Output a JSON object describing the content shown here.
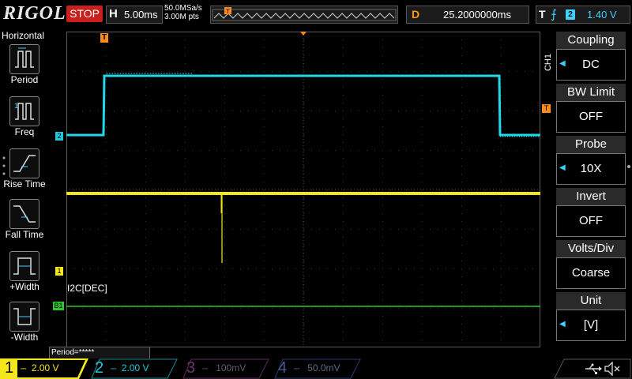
{
  "header": {
    "logo": "RIGOL",
    "run_state": "STOP",
    "horizontal": {
      "label": "H",
      "value": "5.00ms"
    },
    "sample_rate": "50.0MSa/s",
    "memory_depth": "3.00M pts",
    "delay": {
      "label": "D",
      "value": "25.2000000ms"
    },
    "trigger": {
      "label": "T",
      "edge_icon": "rising-edge-icon",
      "channel": "2",
      "level": "1.40 V"
    }
  },
  "left_menu": {
    "title": "Horizontal",
    "items": [
      {
        "label": "Period",
        "icon": "period-icon"
      },
      {
        "label": "Freq",
        "icon": "freq-icon"
      },
      {
        "label": "Rise Time",
        "icon": "rise-time-icon"
      },
      {
        "label": "Fall Time",
        "icon": "fall-time-icon"
      },
      {
        "label": "+Width",
        "icon": "positive-width-icon"
      },
      {
        "label": "-Width",
        "icon": "negative-width-icon"
      }
    ]
  },
  "right_menu": {
    "channel_tag": "CH1",
    "items": [
      {
        "title": "Coupling",
        "value": "DC"
      },
      {
        "title": "BW Limit",
        "value": "OFF"
      },
      {
        "title": "Probe",
        "value": "10X"
      },
      {
        "title": "Invert",
        "value": "OFF"
      },
      {
        "title": "Volts/Div",
        "value": "Coarse"
      },
      {
        "title": "Unit",
        "value": "[V]"
      }
    ]
  },
  "markers": {
    "trigger_marker": "T",
    "ch1": "1",
    "ch2": "2",
    "bus": "B1",
    "trigger_level": "T",
    "bus_label": "I2C[DEC]"
  },
  "measurement": {
    "period": "Period=*****"
  },
  "channels": [
    {
      "num": "1",
      "scale": "2.00 V",
      "color": "#f5e51b",
      "active": true
    },
    {
      "num": "2",
      "scale": "2.00 V",
      "color": "#22c8d8",
      "active": false
    },
    {
      "num": "3",
      "scale": "100mV",
      "color": "#c020c0",
      "active": false
    },
    {
      "num": "4",
      "scale": "50.0mV",
      "color": "#3a6ad8",
      "active": false
    }
  ],
  "colors": {
    "ch1": "#f5e51b",
    "ch2": "#22d8e8",
    "bus": "#2ec82e",
    "trigger": "#ff8c1a",
    "stop": "#c8201c"
  },
  "status_icons": [
    "usb-icon",
    "speaker-muted-icon"
  ]
}
